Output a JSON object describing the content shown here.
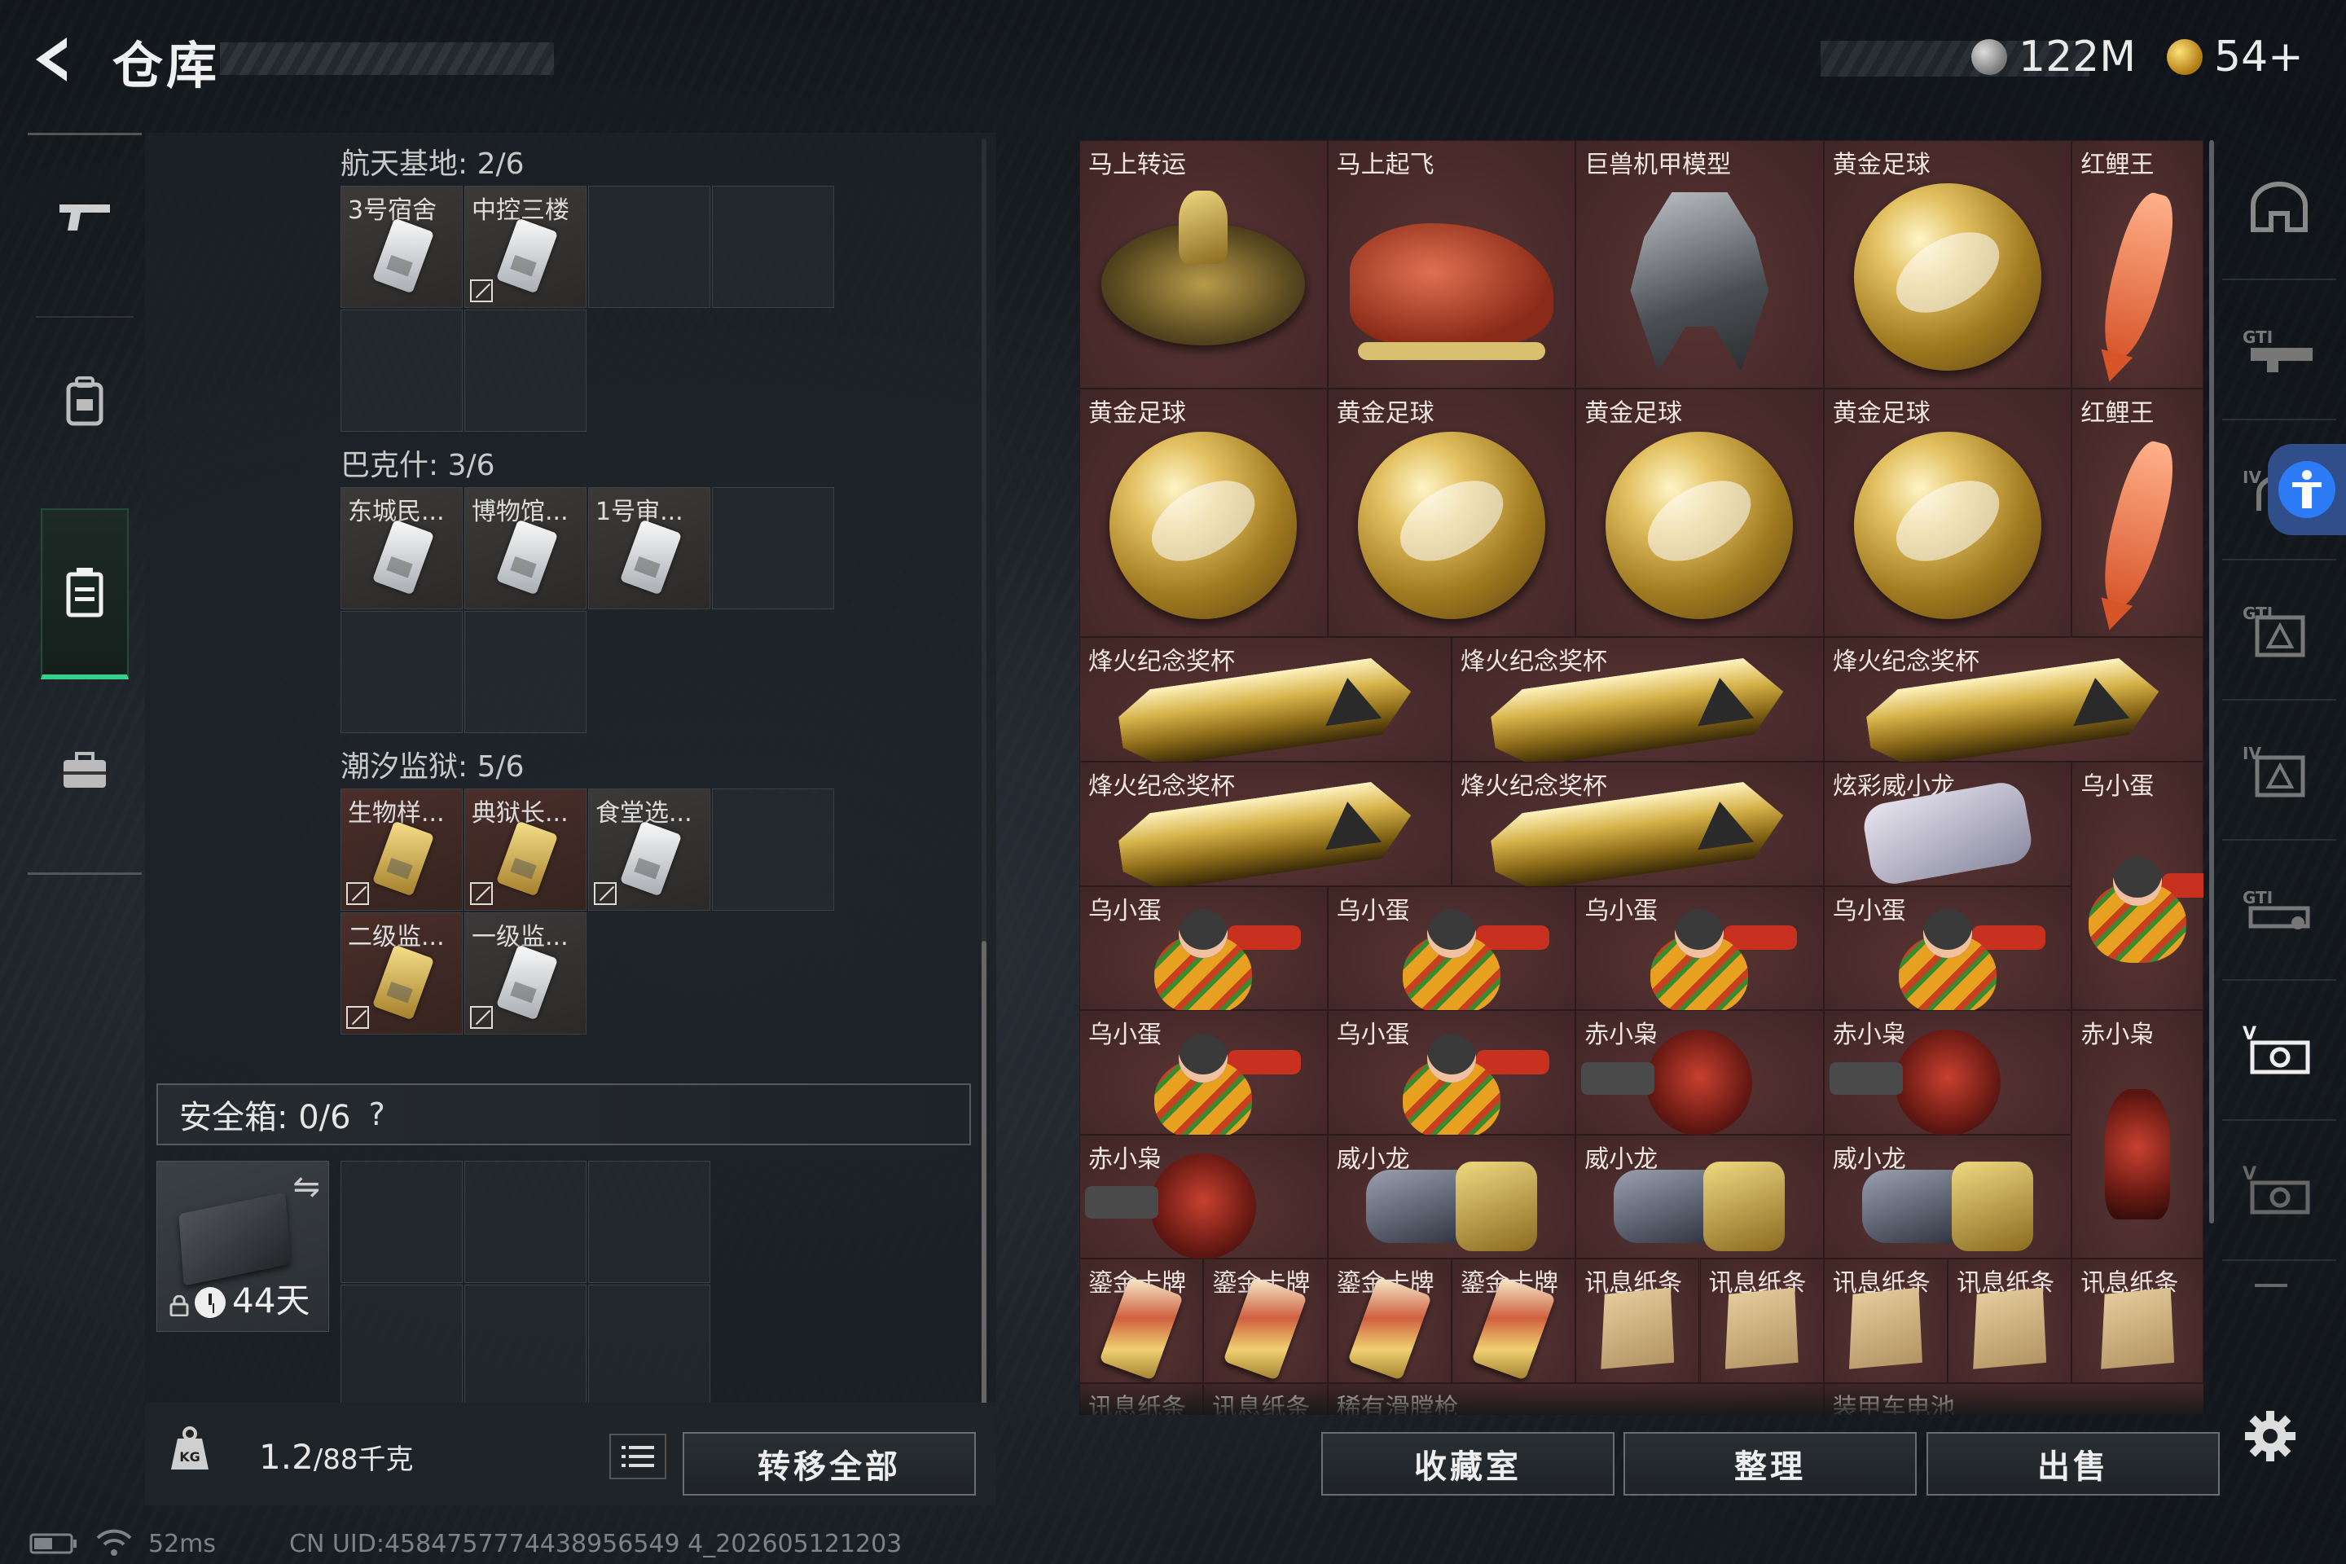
{
  "header": {
    "title": "仓库",
    "currencies": [
      {
        "icon": "silver-coin-icon",
        "value": "122M"
      },
      {
        "icon": "gold-coin-icon",
        "value": "54+"
      }
    ]
  },
  "left_nav": [
    {
      "icon": "gun-icon"
    },
    {
      "icon": "backpack-icon"
    },
    {
      "icon": "warehouse-icon",
      "active": true
    },
    {
      "icon": "briefcase-icon"
    }
  ],
  "key_sections": [
    {
      "title": "航天基地: 2/6",
      "items": [
        {
          "label": "3号宿舍",
          "color": "silver",
          "marked": false
        },
        {
          "label": "中控三楼",
          "color": "silver",
          "marked": true
        }
      ]
    },
    {
      "title": "巴克什: 3/6",
      "items": [
        {
          "label": "东城民...",
          "color": "silver",
          "marked": false
        },
        {
          "label": "博物馆...",
          "color": "silver",
          "marked": false
        },
        {
          "label": "1号审...",
          "color": "silver",
          "marked": false
        }
      ]
    },
    {
      "title": "潮汐监狱: 5/6",
      "items": [
        {
          "label": "生物样...",
          "color": "gold",
          "marked": true
        },
        {
          "label": "典狱长...",
          "color": "gold",
          "marked": true
        },
        {
          "label": "食堂选...",
          "color": "silver",
          "marked": true
        },
        {
          "label": "二级监...",
          "color": "gold",
          "marked": true
        },
        {
          "label": "一级监...",
          "color": "gold",
          "marked": true
        }
      ]
    }
  ],
  "safebox": {
    "label": "安全箱: 0/6",
    "help": "?",
    "expiry_days": "44天"
  },
  "bottom_left": {
    "weight_current": "1.2",
    "weight_rest": "/88千克",
    "transfer_all": "转移全部"
  },
  "warehouse_items": [
    {
      "name": "马上转运",
      "type": "horsecoin"
    },
    {
      "name": "马上起飞",
      "type": "horse"
    },
    {
      "name": "巨兽机甲模型",
      "type": "mech"
    },
    {
      "name": "黄金足球",
      "type": "ball"
    },
    {
      "name": "红鲤王",
      "type": "fish"
    },
    {
      "name": "黄金足球",
      "type": "ball"
    },
    {
      "name": "黄金足球",
      "type": "ball"
    },
    {
      "name": "黄金足球",
      "type": "ball"
    },
    {
      "name": "黄金足球",
      "type": "ball"
    },
    {
      "name": "红鲤王",
      "type": "fish"
    },
    {
      "name": "烽火纪念奖杯",
      "type": "trophy"
    },
    {
      "name": "烽火纪念奖杯",
      "type": "trophy"
    },
    {
      "name": "烽火纪念奖杯",
      "type": "trophy"
    },
    {
      "name": "烽火纪念奖杯",
      "type": "trophy"
    },
    {
      "name": "烽火纪念奖杯",
      "type": "trophy"
    },
    {
      "name": "炫彩威小龙",
      "type": "glove"
    },
    {
      "name": "乌小蛋",
      "type": "egg"
    },
    {
      "name": "乌小蛋",
      "type": "egg"
    },
    {
      "name": "乌小蛋",
      "type": "egg"
    },
    {
      "name": "乌小蛋",
      "type": "egg"
    },
    {
      "name": "乌小蛋",
      "type": "egg"
    },
    {
      "name": "乌小蛋",
      "type": "egg"
    },
    {
      "name": "乌小蛋",
      "type": "egg"
    },
    {
      "name": "赤小枭",
      "type": "owl"
    },
    {
      "name": "赤小枭",
      "type": "owl"
    },
    {
      "name": "赤小枭",
      "type": "owlstand"
    },
    {
      "name": "赤小枭",
      "type": "owl"
    },
    {
      "name": "威小龙",
      "type": "dragon"
    },
    {
      "name": "威小龙",
      "type": "dragon"
    },
    {
      "name": "威小龙",
      "type": "dragon"
    },
    {
      "name": "鎏金卡牌",
      "type": "goldcard"
    },
    {
      "name": "鎏金卡牌",
      "type": "goldcard"
    },
    {
      "name": "鎏金卡牌",
      "type": "goldcard"
    },
    {
      "name": "鎏金卡牌",
      "type": "goldcard"
    },
    {
      "name": "讯息纸条",
      "type": "paper"
    },
    {
      "name": "讯息纸条",
      "type": "paper"
    },
    {
      "name": "讯息纸条",
      "type": "paper"
    },
    {
      "name": "讯息纸条",
      "type": "paper"
    },
    {
      "name": "讯息纸条",
      "type": "paper"
    },
    {
      "name": "讯息纸条",
      "type": "none"
    },
    {
      "name": "讯息纸条",
      "type": "none"
    },
    {
      "name": "稀有滑膛枪",
      "type": "none"
    },
    {
      "name": "装甲车电池",
      "type": "none"
    }
  ],
  "bottom_right": {
    "collection": "收藏室",
    "sort": "整理",
    "sell": "出售"
  },
  "right_tabs": [
    {
      "icon": "helmet-icon"
    },
    {
      "icon": "gti-weapon-icon"
    },
    {
      "icon": "level4-helmet-icon"
    },
    {
      "icon": "gti-armor-icon"
    },
    {
      "icon": "level4-armor-icon"
    },
    {
      "icon": "gti-rig-icon"
    },
    {
      "icon": "v-backpack-icon",
      "active": true
    },
    {
      "icon": "v-backpack-dim-icon"
    },
    {
      "icon": "more-icon"
    }
  ],
  "status": {
    "ping": "52ms",
    "uid": "CN UID:4584757774438956549 4_202605121203"
  }
}
